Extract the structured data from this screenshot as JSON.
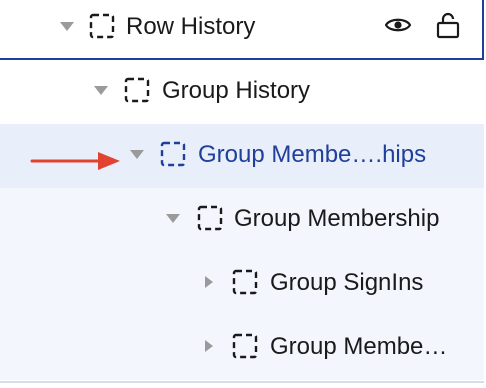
{
  "tree": {
    "items": [
      {
        "label": "Row History",
        "level": 0,
        "expanded": true,
        "selected": false,
        "has_actions": true
      },
      {
        "label": "Group History",
        "level": 1,
        "expanded": true,
        "selected": false
      },
      {
        "label": "Group Membe….hips",
        "level": 2,
        "expanded": true,
        "selected": true
      },
      {
        "label": "Group Membership",
        "level": 3,
        "expanded": true,
        "selected": false
      },
      {
        "label": "Group SignIns",
        "level": 4,
        "expanded": false,
        "selected": false
      },
      {
        "label": "Group Membe…",
        "level": 4,
        "expanded": false,
        "selected": false
      }
    ],
    "actions": {
      "visibility_icon": "eye-icon",
      "lock_icon": "unlock-icon"
    }
  },
  "annotation": {
    "icon": "red-arrow-icon",
    "color": "#e2432f",
    "points_to": "Group Membe….hips"
  },
  "colors": {
    "accent": "#1f3f9a",
    "selected_row_bg": "#e9eefb",
    "child_rows_bg": "#f3f6fd",
    "toggle": "#9a9a9a"
  }
}
